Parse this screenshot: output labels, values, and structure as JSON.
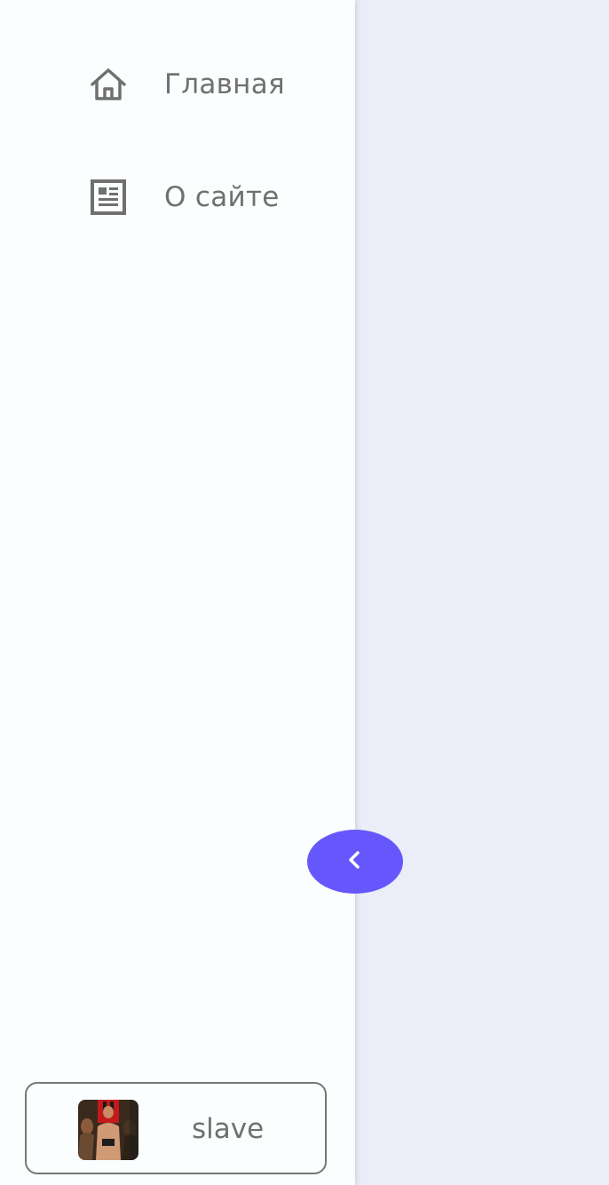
{
  "sidebar": {
    "items": [
      {
        "label": "Главная",
        "icon": "home-icon"
      },
      {
        "label": "О сайте",
        "icon": "article-icon"
      }
    ],
    "collapse_icon": "chevron-left-icon",
    "user": {
      "name": "slave",
      "avatar": "avatar"
    }
  },
  "colors": {
    "drawer_bg": "#fbfefe",
    "content_bg": "#ebedf8",
    "accent": "#6557fb",
    "text": "#707070"
  }
}
